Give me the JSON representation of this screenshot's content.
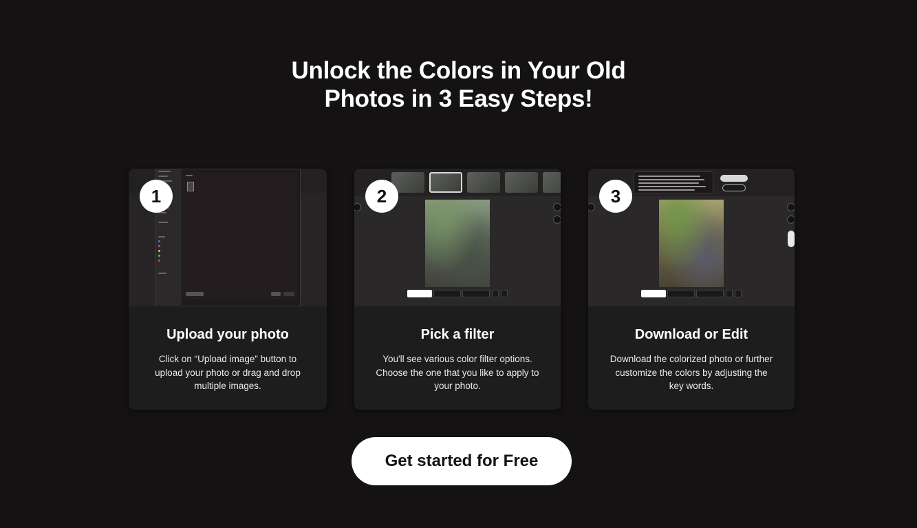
{
  "headline": {
    "line1": "Unlock the Colors in Your Old",
    "line2": "Photos in 3 Easy Steps!"
  },
  "steps": [
    {
      "number": "1",
      "title": "Upload your photo",
      "description": "Click on “Upload image” button to upload your photo or drag and drop multiple images."
    },
    {
      "number": "2",
      "title": "Pick a filter",
      "description": "You'll see various color filter options. Choose the one that you like to apply to your photo."
    },
    {
      "number": "3",
      "title": "Download or Edit",
      "description": "Download the colorized photo or further customize the colors by adjusting the key words."
    }
  ],
  "cta": {
    "label": "Get started for Free"
  },
  "colors": {
    "background": "#141213",
    "card": "#1e1d1e",
    "accent": "#ffffff"
  }
}
